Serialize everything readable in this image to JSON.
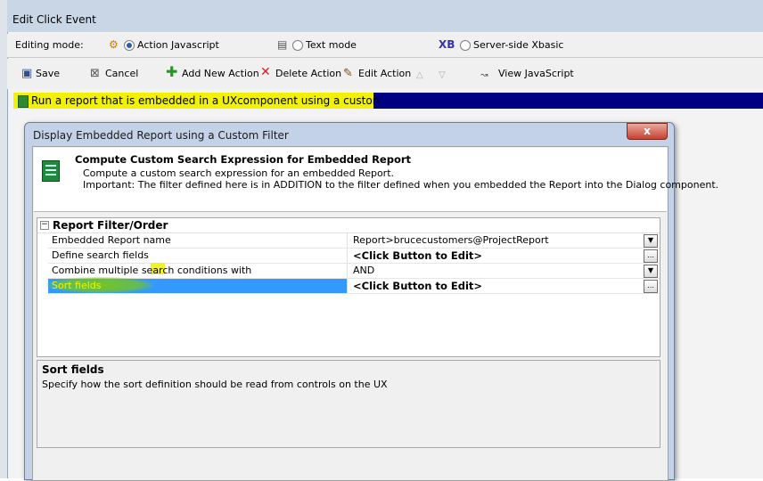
{
  "window": {
    "title": "Edit Click Event"
  },
  "mode_row": {
    "label": "Editing mode:",
    "options": [
      {
        "label": "Action Javascript",
        "selected": true,
        "icon": "action-javascript-icon"
      },
      {
        "label": "Text mode",
        "selected": false,
        "icon": "text-mode-icon"
      },
      {
        "label": "Server-side Xbasic",
        "selected": false,
        "icon": "xb-icon",
        "icon_text": "XB"
      }
    ]
  },
  "toolbar": {
    "save": "Save",
    "cancel": "Cancel",
    "add_action": "Add New Action",
    "delete_action": "Delete Action",
    "edit_action": "Edit Action",
    "view_js": "View JavaScript"
  },
  "selected_action": {
    "text": "Run a report that is embedded in a UXcomponent using a custon"
  },
  "dialog": {
    "title": "Display Embedded Report using a Custom Filter",
    "close_label": "x",
    "header": {
      "title": "Compute Custom Search Expression for Embedded Report",
      "line1": "Compute a custom search expression for an embedded Report.",
      "line2": "Important: The filter defined here is in ADDITION to the filter defined when you embedded the Report into the Dialog component."
    },
    "grid": {
      "group": "Report Filter/Order",
      "rows": [
        {
          "name": "Embedded Report name",
          "value": "Report>brucecustomers@ProjectReport",
          "button": "dropdown"
        },
        {
          "name": "Define search fields",
          "value": "<Click Button to Edit>",
          "button": "ellipsis"
        },
        {
          "name": "Combine multiple search conditions with",
          "value": "AND",
          "button": "dropdown"
        },
        {
          "name": "Sort fields",
          "value": "<Click Button to Edit>",
          "button": "ellipsis",
          "selected": true
        }
      ]
    },
    "description": {
      "title": "Sort fields",
      "text": "Specify how the sort definition should be read from controls on the UX"
    }
  },
  "colors": {
    "selection_bar": "#000080",
    "highlight_yellow": "#f2f200",
    "row_selected": "#3399ff",
    "highlight_green": "#78c814"
  }
}
